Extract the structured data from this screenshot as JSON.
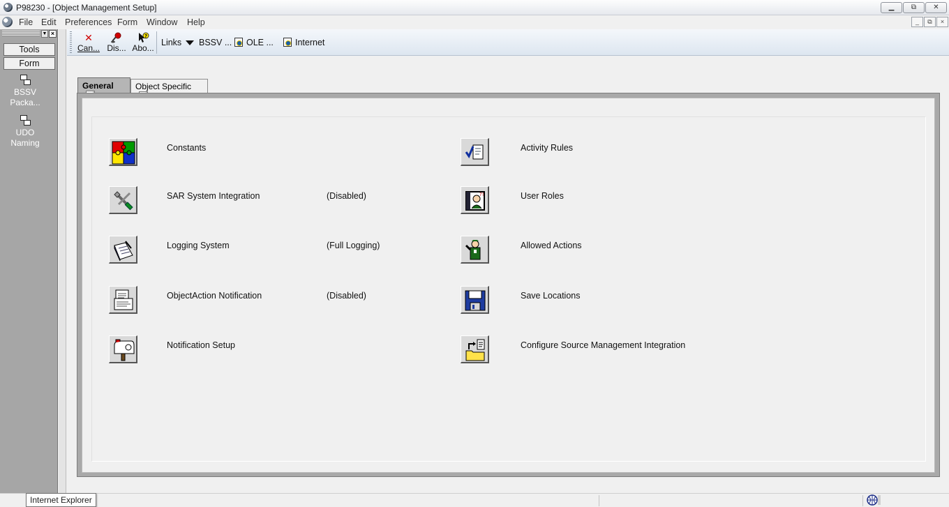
{
  "window": {
    "title": "P98230 - [Object Management Setup]",
    "controls": [
      "▁",
      "⧉",
      "✕"
    ]
  },
  "menu": {
    "items": [
      "File",
      "Edit",
      "Preferences",
      "Form",
      "Window",
      "Help"
    ],
    "mdi_controls": [
      "_",
      "⧉",
      "×"
    ]
  },
  "sidebar": {
    "tabs": [
      "Tools",
      "Form"
    ],
    "items": [
      {
        "label": "BSSV Packa...",
        "icon": "tree-node-icon"
      },
      {
        "label": "UDO Naming",
        "icon": "tree-node-icon"
      }
    ]
  },
  "toolbar": {
    "buttons": [
      {
        "label": "Can...",
        "accel": "C",
        "icon": "cancel-x-icon"
      },
      {
        "label": "Dis...",
        "accel": "s",
        "icon": "display-pin-icon"
      },
      {
        "label": "Abo...",
        "accel": "b",
        "icon": "about-help-icon"
      }
    ],
    "links_label": "Links",
    "links": [
      "BSSV ...",
      "OLE ...",
      "Internet"
    ]
  },
  "tabs": {
    "general": "General",
    "object_specific": "Object Specific"
  },
  "options_left": [
    {
      "label": "Constants",
      "status": "",
      "icon": "puzzle-icon"
    },
    {
      "label": "SAR System Integration",
      "status": "(Disabled)",
      "icon": "tools-icon"
    },
    {
      "label": "Logging System",
      "status": "(Full Logging)",
      "icon": "logbook-icon"
    },
    {
      "label": "ObjectAction Notification",
      "status": "(Disabled)",
      "icon": "documents-icon"
    },
    {
      "label": "Notification Setup",
      "status": "",
      "icon": "mailbox-icon"
    }
  ],
  "options_right": [
    {
      "label": "Activity Rules",
      "icon": "checklist-icon"
    },
    {
      "label": "User Roles",
      "icon": "user-roles-icon"
    },
    {
      "label": "Allowed Actions",
      "icon": "person-action-icon"
    },
    {
      "label": "Save Locations",
      "icon": "floppy-disk-icon"
    },
    {
      "label": "Configure Source Management Integration",
      "icon": "source-folder-icon"
    }
  ],
  "statusbar": {
    "tooltip": "Internet Explorer"
  },
  "colors": {
    "panel_frame": "#a9a9a9",
    "toolbar_bg": "#dde6f0",
    "sidebar_bg": "#a6a6a6"
  }
}
